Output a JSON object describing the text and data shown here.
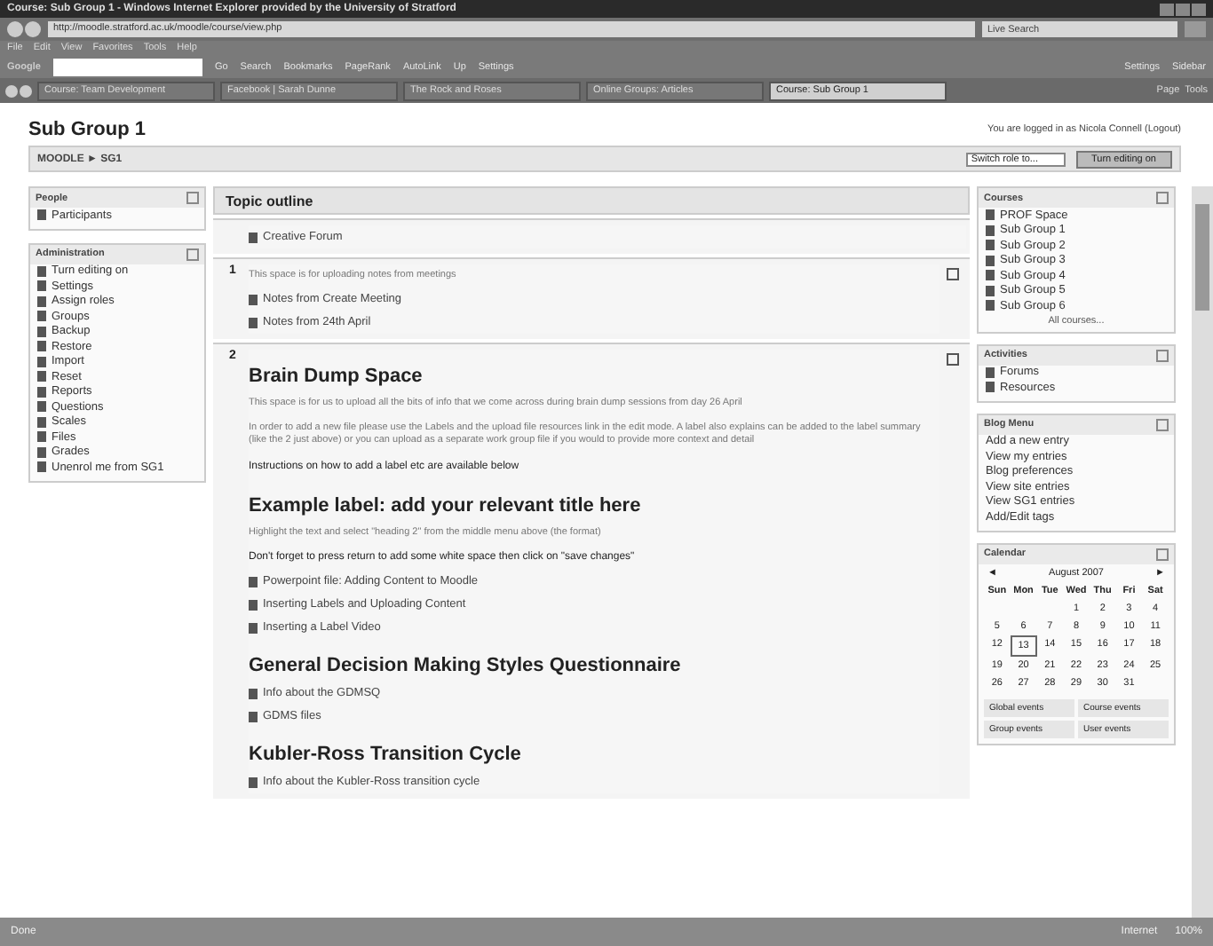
{
  "window": {
    "title": "Course: Sub Group 1 - Windows Internet Explorer provided by the University of Stratford"
  },
  "address_bar": {
    "url": "http://moodle.stratford.ac.uk/moodle/course/view.php",
    "search_placeholder": "Live Search"
  },
  "menu": [
    "File",
    "Edit",
    "View",
    "Favorites",
    "Tools",
    "Help"
  ],
  "google_toolbar": {
    "label": "Google",
    "items": [
      "Go",
      "Search",
      "Bookmarks",
      "PageRank",
      "AutoLink",
      "Up",
      "Settings"
    ],
    "right_items": [
      "Settings",
      "Sidebar"
    ]
  },
  "tabs": [
    {
      "label": "Course: Team Development",
      "selected": false
    },
    {
      "label": "Facebook | Sarah Dunne",
      "selected": false
    },
    {
      "label": "The Rock and Roses",
      "selected": false
    },
    {
      "label": "Online Groups: Articles",
      "selected": false
    },
    {
      "label": "Course: Sub Group 1",
      "selected": true
    }
  ],
  "command_bar": [
    "Page",
    "Tools"
  ],
  "page": {
    "title": "Sub Group 1",
    "login": "You are logged in as Nicola Connell (Logout)",
    "breadcrumb": "MOODLE ► SG1",
    "role_select": "Switch role to...",
    "edit_button": "Turn editing on"
  },
  "left_blocks": [
    {
      "title": "People",
      "items": [
        "Participants"
      ]
    },
    {
      "title": "Administration",
      "items": [
        "Turn editing on",
        "Settings",
        "Assign roles",
        "Groups",
        "Backup",
        "Restore",
        "Import",
        "Reset",
        "Reports",
        "Questions",
        "Scales",
        "Files",
        "Grades",
        "Unenrol me from SG1"
      ]
    }
  ],
  "topic_outline": {
    "title": "Topic outline",
    "sections": [
      {
        "items": [
          {
            "kind": "link",
            "text": "Creative Forum"
          }
        ]
      },
      {
        "number": "1",
        "items": [
          {
            "kind": "text",
            "text": "This space is for uploading notes from meetings"
          },
          {
            "kind": "link",
            "text": "Notes from Create Meeting"
          },
          {
            "kind": "link",
            "text": "Notes from 24th April"
          }
        ]
      },
      {
        "number": "2",
        "items": [
          {
            "kind": "heading",
            "text": "Brain Dump Space"
          },
          {
            "kind": "text",
            "text": "This space is for us to upload all the bits of info that we come across during brain dump sessions from day 26 April"
          },
          {
            "kind": "text",
            "text": "In order to add a new file please use the Labels and the upload file resources link in the edit mode. A label also explains can be added to the label summary (like the 2 just above) or you can upload as a separate work group file if you would to provide more context and detail"
          },
          {
            "kind": "dark",
            "text": "Instructions on how to add a label etc are available below"
          },
          {
            "kind": "heading",
            "text": "Example label: add your relevant title here"
          },
          {
            "kind": "text",
            "text": "Highlight the text and select \"heading 2\" from the middle menu above (the format)"
          },
          {
            "kind": "dark",
            "text": "Don't forget to press return to add some white space then click on \"save changes\""
          },
          {
            "kind": "link",
            "text": "Powerpoint file: Adding Content to Moodle"
          },
          {
            "kind": "link",
            "text": "Inserting Labels and Uploading Content"
          },
          {
            "kind": "link",
            "text": "Inserting a Label Video"
          },
          {
            "kind": "heading",
            "text": "General Decision Making Styles Questionnaire"
          },
          {
            "kind": "link",
            "text": "Info about the GDMSQ"
          },
          {
            "kind": "link",
            "text": "GDMS files"
          },
          {
            "kind": "heading",
            "text": "Kubler-Ross Transition Cycle"
          },
          {
            "kind": "link",
            "text": "Info about the Kubler-Ross transition cycle"
          }
        ]
      }
    ]
  },
  "right_blocks": [
    {
      "title": "Courses",
      "kind": "icons",
      "items": [
        "PROF Space",
        "Sub Group 1",
        "Sub Group 2",
        "Sub Group 3",
        "Sub Group 4",
        "Sub Group 5",
        "Sub Group 6"
      ],
      "footer": "All courses..."
    },
    {
      "title": "Activities",
      "kind": "icons",
      "items": [
        "Forums",
        "Resources"
      ]
    },
    {
      "title": "Blog Menu",
      "kind": "plain",
      "items": [
        "Add a new entry",
        "View my entries",
        "Blog preferences",
        "View site entries",
        "View SG1 entries",
        "Add/Edit tags"
      ]
    }
  ],
  "calendar": {
    "title": "Calendar",
    "prev": "◄",
    "month": "August 2007",
    "next": "►",
    "weekdays": [
      "Sun",
      "Mon",
      "Tue",
      "Wed",
      "Thu",
      "Fri",
      "Sat"
    ],
    "weeks": [
      {
        "kind": "lead",
        "days": [
          {
            "d": "1",
            "today": false
          },
          {
            "d": "2",
            "today": false
          },
          {
            "d": "3",
            "today": false
          },
          {
            "d": "4",
            "today": false
          }
        ]
      },
      {
        "kind": "full",
        "days": [
          {
            "d": "5",
            "today": false
          },
          {
            "d": "6",
            "today": false
          },
          {
            "d": "7",
            "today": false
          },
          {
            "d": "8",
            "today": false
          },
          {
            "d": "9",
            "today": false
          },
          {
            "d": "10",
            "today": false
          },
          {
            "d": "11",
            "today": false
          }
        ]
      },
      {
        "kind": "full",
        "days": [
          {
            "d": "12",
            "today": false
          },
          {
            "d": "13",
            "today": true
          },
          {
            "d": "14",
            "today": false
          },
          {
            "d": "15",
            "today": false
          },
          {
            "d": "16",
            "today": false
          },
          {
            "d": "17",
            "today": false
          },
          {
            "d": "18",
            "today": false
          }
        ]
      },
      {
        "kind": "full",
        "days": [
          {
            "d": "19",
            "today": false
          },
          {
            "d": "20",
            "today": false
          },
          {
            "d": "21",
            "today": false
          },
          {
            "d": "22",
            "today": false
          },
          {
            "d": "23",
            "today": false
          },
          {
            "d": "24",
            "today": false
          },
          {
            "d": "25",
            "today": false
          }
        ]
      },
      {
        "kind": "full",
        "days": [
          {
            "d": "26",
            "today": false
          },
          {
            "d": "27",
            "today": false
          },
          {
            "d": "28",
            "today": false
          },
          {
            "d": "29",
            "today": false
          },
          {
            "d": "30",
            "today": false
          },
          {
            "d": "31",
            "today": false
          }
        ]
      }
    ],
    "legend": [
      "Global events",
      "Course events",
      "Group events",
      "User events"
    ]
  },
  "status_bar": {
    "status": "Done",
    "zone": "Internet",
    "zoom": "100%"
  }
}
